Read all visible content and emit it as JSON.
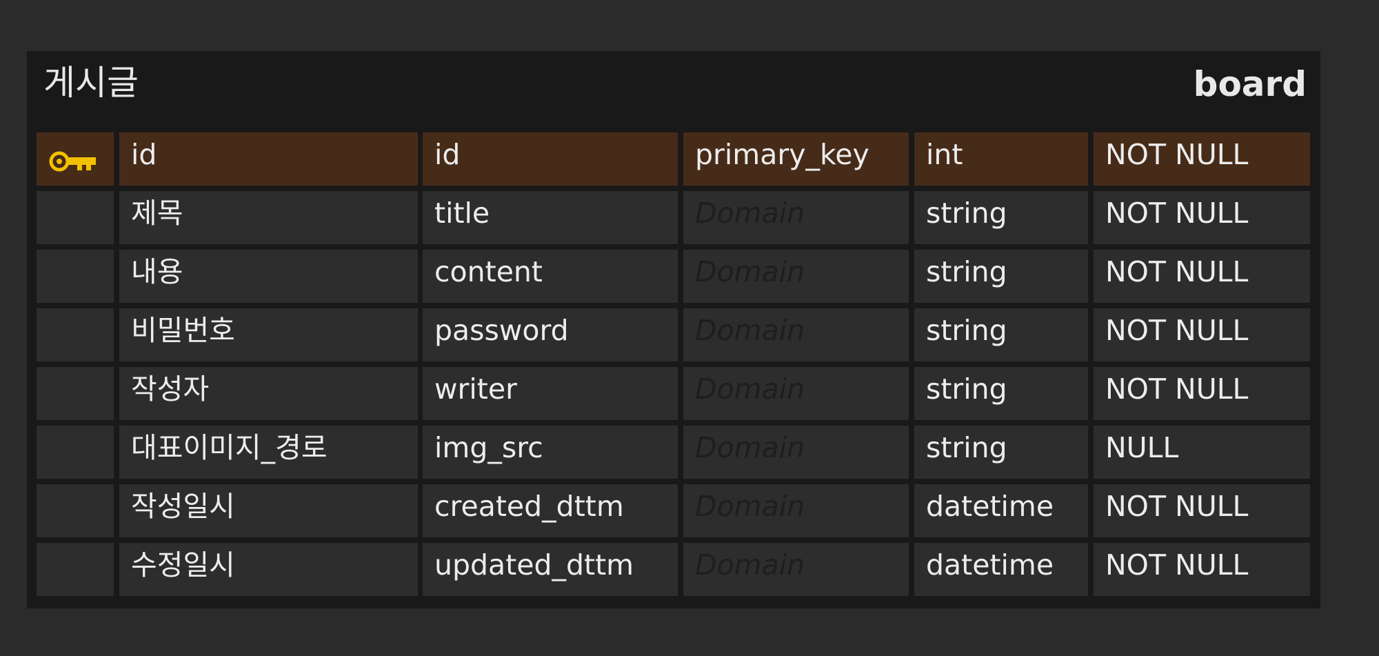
{
  "entity": {
    "logical_name": "게시글",
    "physical_name": "board"
  },
  "columns": [
    {
      "key": true,
      "key_icon": "key-icon",
      "logical": "id",
      "physical": "id",
      "domain": "primary_key",
      "domain_is_placeholder": false,
      "type": "int",
      "nullability": "NOT NULL"
    },
    {
      "key": false,
      "logical": "제목",
      "physical": "title",
      "domain": "Domain",
      "domain_is_placeholder": true,
      "type": "string",
      "nullability": "NOT NULL"
    },
    {
      "key": false,
      "logical": "내용",
      "physical": "content",
      "domain": "Domain",
      "domain_is_placeholder": true,
      "type": "string",
      "nullability": "NOT NULL"
    },
    {
      "key": false,
      "logical": "비밀번호",
      "physical": "password",
      "domain": "Domain",
      "domain_is_placeholder": true,
      "type": "string",
      "nullability": "NOT NULL"
    },
    {
      "key": false,
      "logical": "작성자",
      "physical": "writer",
      "domain": "Domain",
      "domain_is_placeholder": true,
      "type": "string",
      "nullability": "NOT NULL"
    },
    {
      "key": false,
      "logical": "대표이미지_경로",
      "physical": "img_src",
      "domain": "Domain",
      "domain_is_placeholder": true,
      "type": "string",
      "nullability": "NULL"
    },
    {
      "key": false,
      "logical": "작성일시",
      "physical": "created_dttm",
      "domain": "Domain",
      "domain_is_placeholder": true,
      "type": "datetime",
      "nullability": "NOT NULL"
    },
    {
      "key": false,
      "logical": "수정일시",
      "physical": "updated_dttm",
      "domain": "Domain",
      "domain_is_placeholder": true,
      "type": "datetime",
      "nullability": "NOT NULL"
    }
  ],
  "colors": {
    "background": "#2b2b2b",
    "entity_background": "#191919",
    "cell_background": "#2d2d2d",
    "primary_key_row": "#472b19",
    "key_icon": "#f2c200",
    "text": "#ededed",
    "placeholder_text": "#1e1e1e"
  }
}
